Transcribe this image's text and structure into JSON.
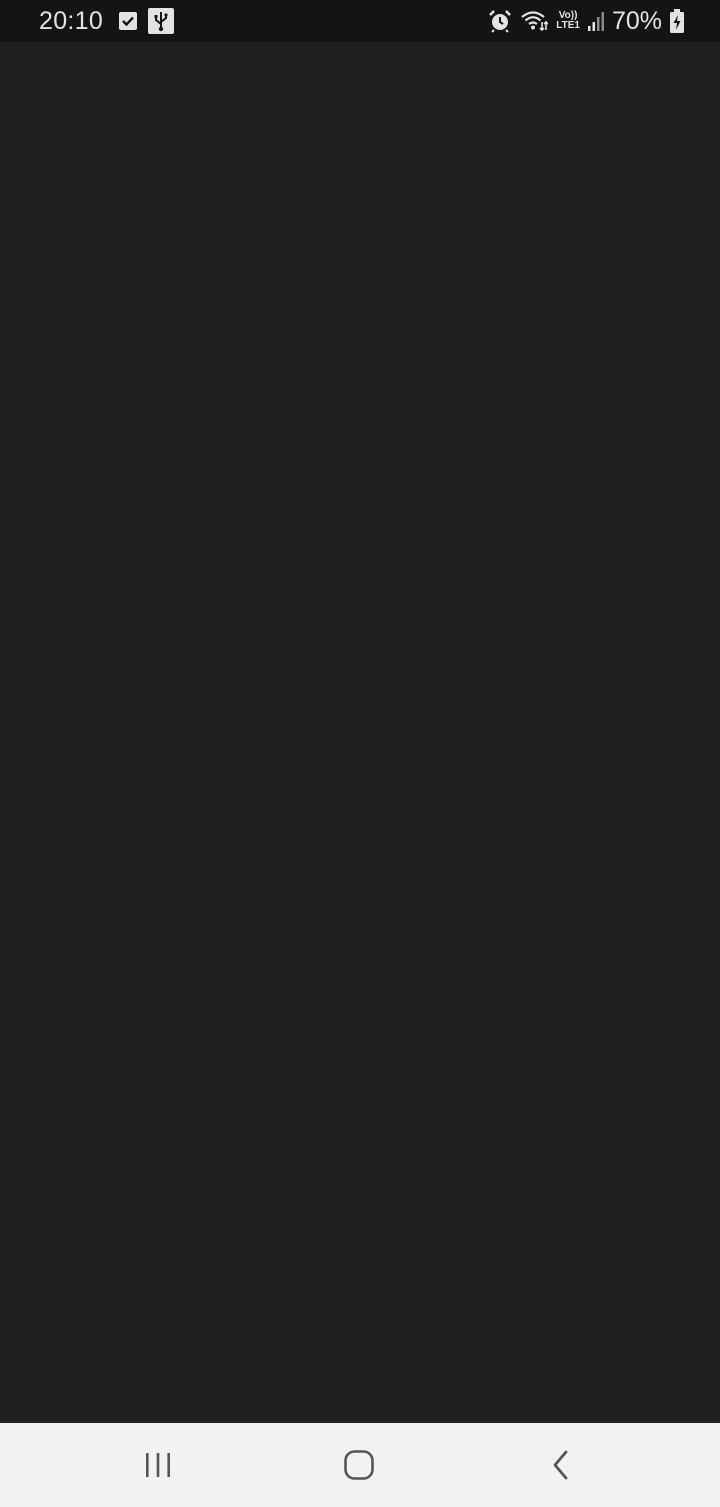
{
  "status_bar": {
    "time": "20:10",
    "battery_percent": "70%",
    "network_top": "Vo))",
    "network_bottom": "LTE1",
    "icons": [
      "checkbox-icon",
      "usb-icon",
      "alarm-icon",
      "wifi-icon",
      "volte-lte-icon",
      "signal-icon",
      "battery-charging-icon"
    ]
  },
  "nav_bar": {
    "icons": [
      "recent-apps-icon",
      "home-icon",
      "back-icon"
    ]
  },
  "colors": {
    "status_bar_bg": "#141414",
    "content_bg": "#202020",
    "nav_bar_bg": "#f2f2f2",
    "nav_icon": "#555555"
  }
}
